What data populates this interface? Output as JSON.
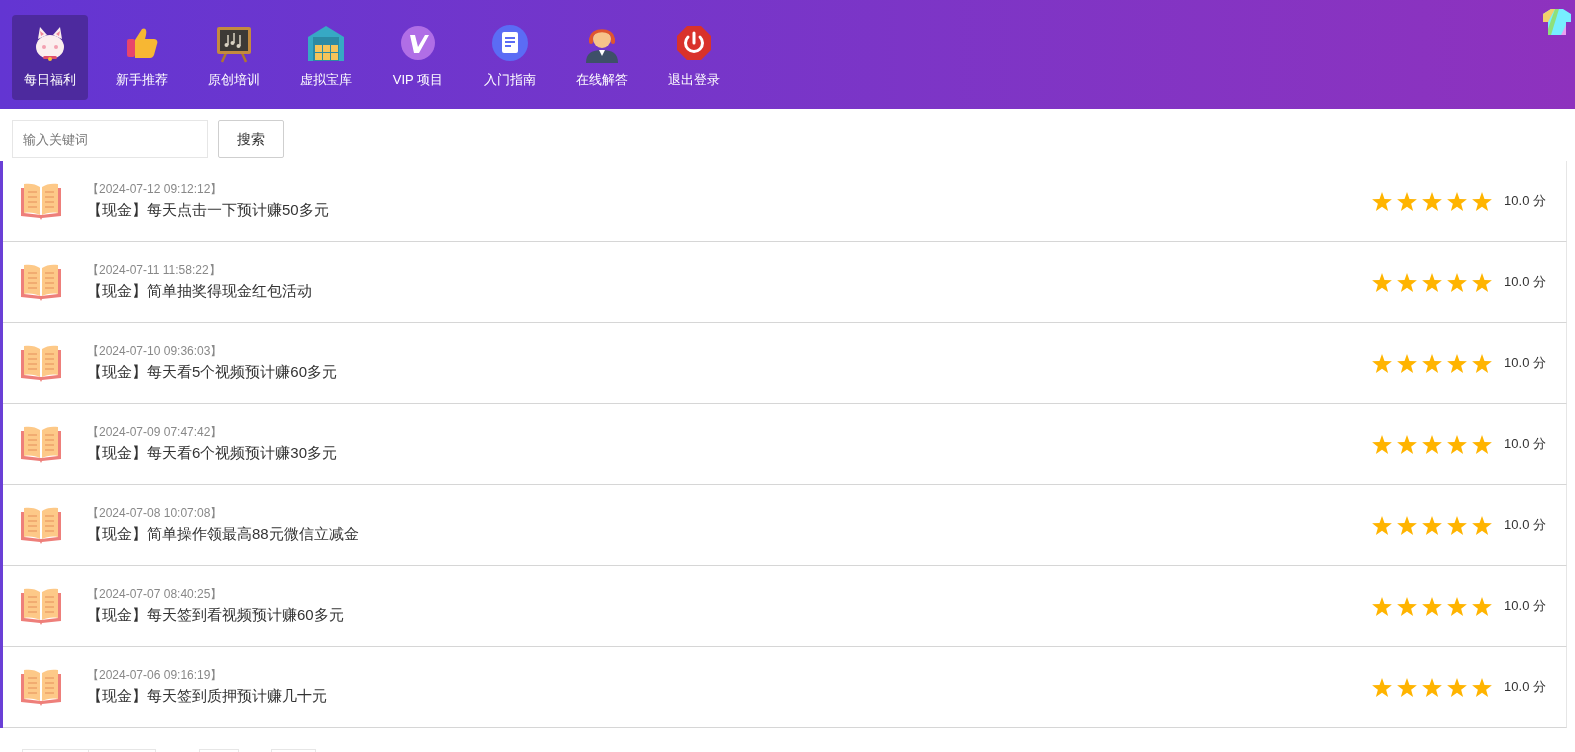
{
  "nav": [
    {
      "label": "每日福利",
      "selected": true
    },
    {
      "label": "新手推荐",
      "selected": false
    },
    {
      "label": "原创培训",
      "selected": false
    },
    {
      "label": "虚拟宝库",
      "selected": false
    },
    {
      "label": "VIP 项目",
      "selected": false
    },
    {
      "label": "入门指南",
      "selected": false
    },
    {
      "label": "在线解答",
      "selected": false
    },
    {
      "label": "退出登录",
      "selected": false
    }
  ],
  "search": {
    "placeholder": "输入关键词",
    "button": "搜索"
  },
  "items": [
    {
      "date": "【2024-07-12 09:12:12】",
      "title": "【现金】每天点击一下预计赚50多元",
      "stars": 5,
      "score": "10.0 分"
    },
    {
      "date": "【2024-07-11 11:58:22】",
      "title": "【现金】简单抽奖得现金红包活动",
      "stars": 5,
      "score": "10.0 分"
    },
    {
      "date": "【2024-07-10 09:36:03】",
      "title": "【现金】每天看5个视频预计赚60多元",
      "stars": 5,
      "score": "10.0 分"
    },
    {
      "date": "【2024-07-09 07:47:42】",
      "title": "【现金】每天看6个视频预计赚30多元",
      "stars": 5,
      "score": "10.0 分"
    },
    {
      "date": "【2024-07-08 10:07:08】",
      "title": "【现金】简单操作领最高88元微信立减金",
      "stars": 5,
      "score": "10.0 分"
    },
    {
      "date": "【2024-07-07 08:40:25】",
      "title": "【现金】每天签到看视频预计赚60多元",
      "stars": 5,
      "score": "10.0 分"
    },
    {
      "date": "【2024-07-06 09:16:19】",
      "title": "【现金】每天签到质押预计赚几十元",
      "stars": 5,
      "score": "10.0 分"
    }
  ]
}
